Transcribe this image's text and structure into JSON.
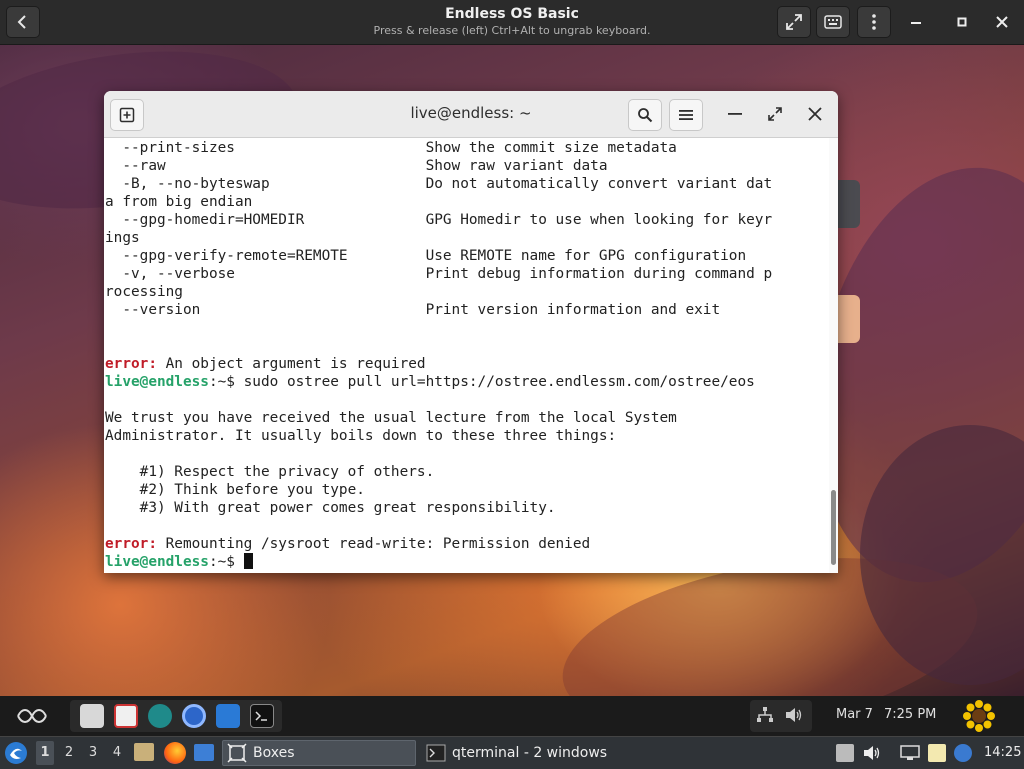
{
  "vm": {
    "title": "Endless OS Basic",
    "subtitle": "Press & release (left) Ctrl+Alt to ungrab keyboard."
  },
  "terminal": {
    "title": "live@endless: ~",
    "lines": [
      {
        "parts": [
          {
            "t": "  --print-sizes                      Show the commit size metadata",
            "c": ""
          }
        ]
      },
      {
        "parts": [
          {
            "t": "  --raw                              Show raw variant data",
            "c": ""
          }
        ]
      },
      {
        "parts": [
          {
            "t": "  -B, --no-byteswap                  Do not automatically convert variant dat",
            "c": ""
          }
        ]
      },
      {
        "parts": [
          {
            "t": "a from big endian",
            "c": ""
          }
        ]
      },
      {
        "parts": [
          {
            "t": "  --gpg-homedir=HOMEDIR              GPG Homedir to use when looking for keyr",
            "c": ""
          }
        ]
      },
      {
        "parts": [
          {
            "t": "ings",
            "c": ""
          }
        ]
      },
      {
        "parts": [
          {
            "t": "  --gpg-verify-remote=REMOTE         Use REMOTE name for GPG configuration",
            "c": ""
          }
        ]
      },
      {
        "parts": [
          {
            "t": "  -v, --verbose                      Print debug information during command p",
            "c": ""
          }
        ]
      },
      {
        "parts": [
          {
            "t": "rocessing",
            "c": ""
          }
        ]
      },
      {
        "parts": [
          {
            "t": "  --version                          Print version information and exit",
            "c": ""
          }
        ]
      },
      {
        "parts": [
          {
            "t": "",
            "c": ""
          }
        ]
      },
      {
        "parts": [
          {
            "t": "",
            "c": ""
          }
        ]
      },
      {
        "parts": [
          {
            "t": "error:",
            "c": "err"
          },
          {
            "t": " An object argument is required",
            "c": ""
          }
        ]
      },
      {
        "parts": [
          {
            "t": "live@endless",
            "c": "prompt"
          },
          {
            "t": ":~$ sudo ostree pull url=https://ostree.endlessm.com/ostree/eos",
            "c": ""
          }
        ]
      },
      {
        "parts": [
          {
            "t": "",
            "c": ""
          }
        ]
      },
      {
        "parts": [
          {
            "t": "We trust you have received the usual lecture from the local System",
            "c": ""
          }
        ]
      },
      {
        "parts": [
          {
            "t": "Administrator. It usually boils down to these three things:",
            "c": ""
          }
        ]
      },
      {
        "parts": [
          {
            "t": "",
            "c": ""
          }
        ]
      },
      {
        "parts": [
          {
            "t": "    #1) Respect the privacy of others.",
            "c": ""
          }
        ]
      },
      {
        "parts": [
          {
            "t": "    #2) Think before you type.",
            "c": ""
          }
        ]
      },
      {
        "parts": [
          {
            "t": "    #3) With great power comes great responsibility.",
            "c": ""
          }
        ]
      },
      {
        "parts": [
          {
            "t": "",
            "c": ""
          }
        ]
      },
      {
        "parts": [
          {
            "t": "error:",
            "c": "err"
          },
          {
            "t": " Remounting /sysroot read-write: Permission denied",
            "c": ""
          }
        ]
      },
      {
        "parts": [
          {
            "t": "live@endless",
            "c": "prompt"
          },
          {
            "t": ":~$ ",
            "c": ""
          }
        ],
        "cursor": true
      }
    ]
  },
  "guest_panel": {
    "date": "Mar 7",
    "time": "7:25 PM"
  },
  "host_taskbar": {
    "workspaces": [
      "1",
      "2",
      "3",
      "4"
    ],
    "active_workspace": "1",
    "tasks": [
      {
        "label": "Boxes",
        "active": true
      },
      {
        "label": "qterminal - 2 windows",
        "active": false
      }
    ],
    "clock": "14:25"
  }
}
